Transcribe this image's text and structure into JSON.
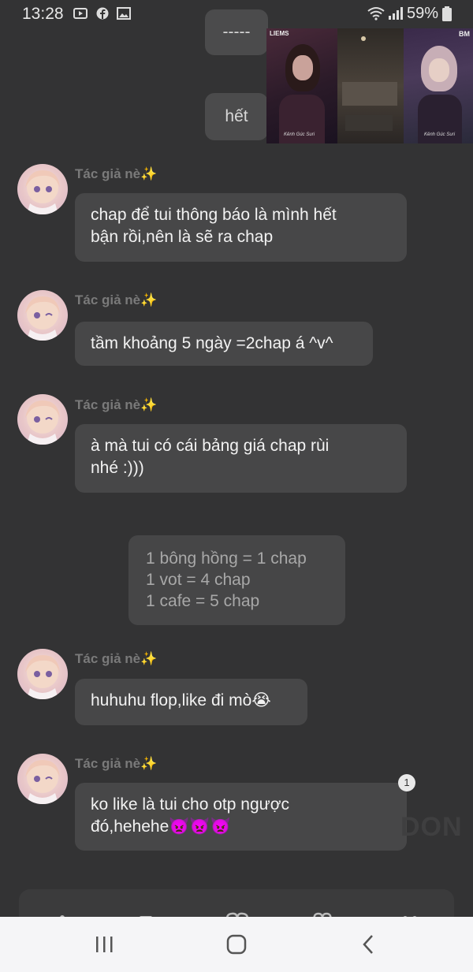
{
  "status_bar": {
    "time": "13:28",
    "battery": "59%",
    "icons": [
      "youtube-icon",
      "facebook-icon",
      "image-icon",
      "wifi-icon",
      "signal-icon",
      "battery-icon"
    ]
  },
  "top_messages": [
    {
      "text": "-----"
    },
    {
      "text": "hết"
    }
  ],
  "chat": [
    {
      "author": "Tác giả nè✨",
      "text_lines": [
        "chap để tui thông báo là mình hết",
        "bận rồi,nên là sẽ ra chap"
      ]
    },
    {
      "author": "Tác giả nè✨",
      "text_lines": [
        "tầm khoảng 5 ngày =2chap á ^v^"
      ]
    },
    {
      "author": "Tác giả nè✨",
      "text_lines": [
        "à mà tui có cái bảng giá chap rùi",
        "nhé :)))"
      ]
    },
    {
      "author": "Tác giả nè✨",
      "text_lines": [
        "huhuhu flop,like đi mò😭"
      ]
    },
    {
      "author": "Tác giả nè✨",
      "text_lines": [
        "ko like là tui cho otp ngược",
        "đó,hehehe👿👿👿"
      ]
    }
  ],
  "price_notice": {
    "lines": [
      "1 bông hồng  = 1 chap",
      "1 vot = 4 chap",
      "1 cafe = 5 chap"
    ]
  },
  "badge_count": "1",
  "watermark": "DON",
  "image_texts": {
    "left_top": "LIEMS",
    "right_top": "BM",
    "caption_left": "Kênh Gúc Suri",
    "caption_right": "Kênh Gúc Suri"
  },
  "colors": {
    "background": "#333334",
    "bubble": "#474748",
    "author": "#7a7a7a",
    "nav": "#f5f5f7"
  }
}
